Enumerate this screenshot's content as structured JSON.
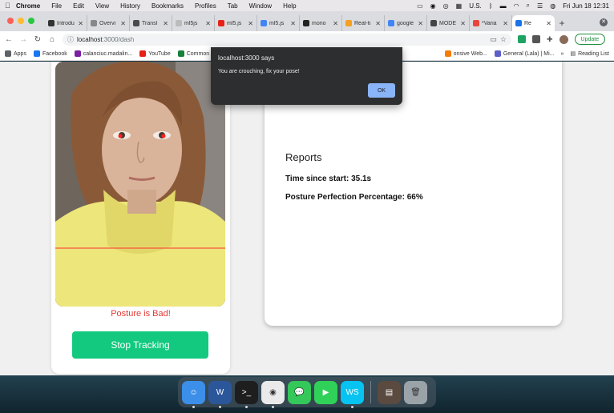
{
  "menubar": {
    "app": "Chrome",
    "items": [
      "File",
      "Edit",
      "View",
      "History",
      "Bookmarks",
      "Profiles",
      "Tab",
      "Window",
      "Help"
    ],
    "input_source": "U.S.",
    "datetime": "Fri Jun 18  12:31"
  },
  "tabs": [
    {
      "label": "Introdu",
      "color": "#333333"
    },
    {
      "label": "Overvi",
      "color": "#888888"
    },
    {
      "label": "Transl",
      "color": "#4a4a4a"
    },
    {
      "label": "ml5js",
      "color": "#bbbbbb"
    },
    {
      "label": "ml5.js",
      "color": "#e62117"
    },
    {
      "label": "ml5.js",
      "color": "#4285f4"
    },
    {
      "label": "mono",
      "color": "#222222"
    },
    {
      "label": "Real-ti",
      "color": "#f4a020"
    },
    {
      "label": "google",
      "color": "#4285f4"
    },
    {
      "label": "MODE",
      "color": "#444444"
    },
    {
      "label": "*Varia",
      "color": "#e8453c"
    },
    {
      "label": "Re",
      "color": "#1a73e8"
    }
  ],
  "toolbar": {
    "url_host": "localhost",
    "url_path": ":3000/dash",
    "update_label": "Update"
  },
  "bookmarks": {
    "items": [
      {
        "label": "Apps",
        "color": "#5f6368"
      },
      {
        "label": "Facebook",
        "color": "#1877f2"
      },
      {
        "label": "calanciuc.madalin...",
        "color": "#7b1fa2"
      },
      {
        "label": "YouTube",
        "color": "#e62117"
      },
      {
        "label": "Common",
        "color": "#188038"
      }
    ],
    "right_items": [
      {
        "label": "onsive Web...",
        "color": "#f57c00"
      },
      {
        "label": "General (Lala) | Mi...",
        "color": "#5b5fc7"
      }
    ],
    "more": "»",
    "reading_list": "Reading List"
  },
  "page": {
    "posture_status": "Posture is Bad!",
    "stop_button": "Stop Tracking",
    "reports_title": "Reports",
    "time_since_start": "Time since start: 35.1s",
    "posture_percentage": "Posture Perfection Percentage: 66%"
  },
  "alert": {
    "title": "localhost:3000 says",
    "message": "You are crouching, fix your pose!",
    "ok": "OK"
  },
  "dock": {
    "apps": [
      {
        "name": "finder-icon",
        "glyph": "☺",
        "color": "#3b8fe8",
        "running": true
      },
      {
        "name": "word-icon",
        "glyph": "W",
        "color": "#2b579a",
        "running": true
      },
      {
        "name": "terminal-icon",
        "glyph": ">_",
        "color": "#1e1e1e",
        "running": true
      },
      {
        "name": "chrome-icon",
        "glyph": "◉",
        "color": "#eaeaea",
        "running": true
      },
      {
        "name": "messages-icon",
        "glyph": "💬",
        "color": "#34c759",
        "running": false
      },
      {
        "name": "facetime-icon",
        "glyph": "▶",
        "color": "#30d158",
        "running": false
      },
      {
        "name": "webstorm-icon",
        "glyph": "WS",
        "color": "#07c3f2",
        "running": true
      }
    ],
    "after_separator": [
      {
        "name": "downloads-stack-icon",
        "glyph": "▤",
        "color": "#5a4a40",
        "running": false
      },
      {
        "name": "trash-icon",
        "glyph": "🗑",
        "color": "#9aa3a8",
        "running": false
      }
    ]
  },
  "colors": {
    "accent_green": "#12c97f",
    "bad_red": "#e53935",
    "alert_bg": "#2d2e30",
    "alert_ok": "#8ab4f8"
  }
}
